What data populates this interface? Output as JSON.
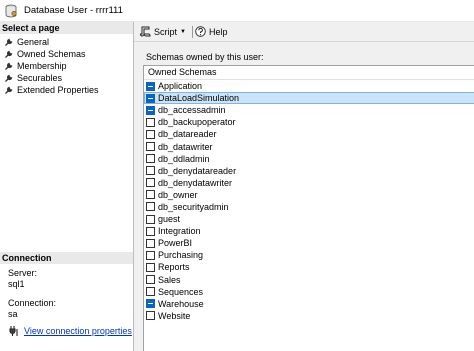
{
  "window": {
    "title": "Database User - rrrr111"
  },
  "left_panel": {
    "select_page_header": "Select a page",
    "pages": [
      {
        "label": "General"
      },
      {
        "label": "Owned Schemas"
      },
      {
        "label": "Membership"
      },
      {
        "label": "Securables"
      },
      {
        "label": "Extended Properties"
      }
    ],
    "connection": {
      "header": "Connection",
      "server_label": "Server:",
      "server_value": "sql1",
      "connection_label": "Connection:",
      "connection_value": "sa",
      "view_link": "View connection properties"
    }
  },
  "toolbar": {
    "script_label": "Script",
    "help_label": "Help"
  },
  "schemas": {
    "label": "Schemas owned by this user:",
    "column_header": "Owned Schemas",
    "items": [
      {
        "name": "Application",
        "checked": true,
        "selected": false
      },
      {
        "name": "DataLoadSimulation",
        "checked": true,
        "selected": true
      },
      {
        "name": "db_accessadmin",
        "checked": true,
        "selected": false
      },
      {
        "name": "db_backupoperator",
        "checked": false,
        "selected": false
      },
      {
        "name": "db_datareader",
        "checked": false,
        "selected": false
      },
      {
        "name": "db_datawriter",
        "checked": false,
        "selected": false
      },
      {
        "name": "db_ddladmin",
        "checked": false,
        "selected": false
      },
      {
        "name": "db_denydatareader",
        "checked": false,
        "selected": false
      },
      {
        "name": "db_denydatawriter",
        "checked": false,
        "selected": false
      },
      {
        "name": "db_owner",
        "checked": false,
        "selected": false
      },
      {
        "name": "db_securityadmin",
        "checked": false,
        "selected": false
      },
      {
        "name": "guest",
        "checked": false,
        "selected": false
      },
      {
        "name": "Integration",
        "checked": false,
        "selected": false
      },
      {
        "name": "PowerBI",
        "checked": false,
        "selected": false
      },
      {
        "name": "Purchasing",
        "checked": false,
        "selected": false
      },
      {
        "name": "Reports",
        "checked": false,
        "selected": false
      },
      {
        "name": "Sales",
        "checked": false,
        "selected": false
      },
      {
        "name": "Sequences",
        "checked": false,
        "selected": false
      },
      {
        "name": "Warehouse",
        "checked": true,
        "selected": false
      },
      {
        "name": "Website",
        "checked": false,
        "selected": false
      }
    ]
  },
  "colors": {
    "checkbox_checked": "#0a64c4",
    "selection": "#cce4f7",
    "link": "#0033cc",
    "section_header": "#e9e9e9"
  }
}
